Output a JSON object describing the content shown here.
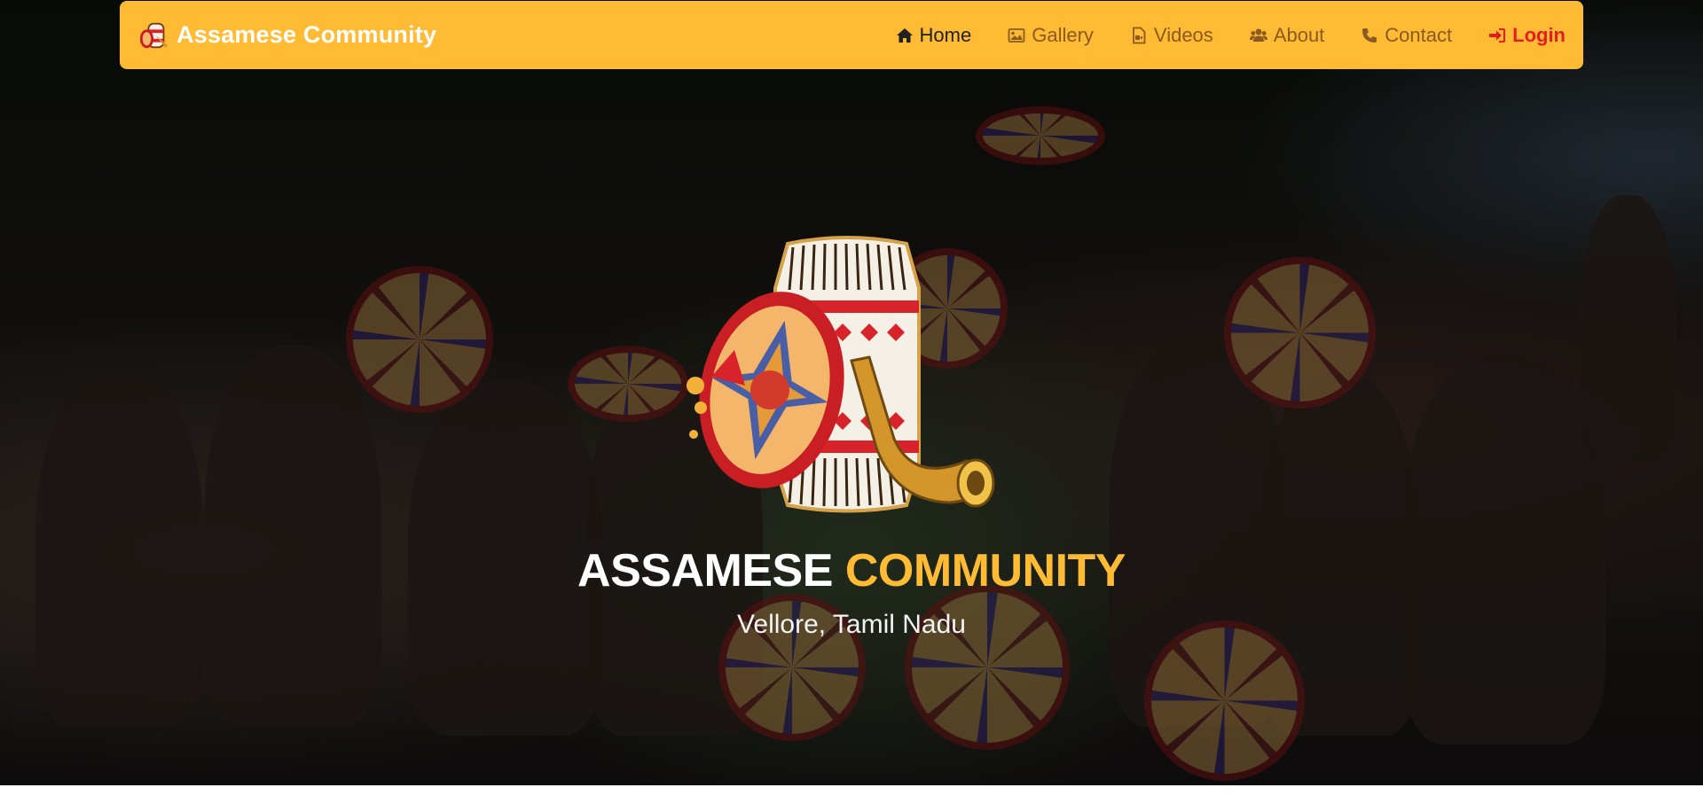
{
  "brand": {
    "name": "Assamese Community"
  },
  "nav": {
    "items": [
      {
        "label": "Home",
        "icon": "home-icon",
        "active": true
      },
      {
        "label": "Gallery",
        "icon": "image-icon"
      },
      {
        "label": "Videos",
        "icon": "file-video-icon"
      },
      {
        "label": "About",
        "icon": "users-icon"
      },
      {
        "label": "Contact",
        "icon": "phone-icon"
      }
    ],
    "login": {
      "label": "Login",
      "icon": "sign-in-icon"
    }
  },
  "hero": {
    "title_part1": "ASSAMESE",
    "title_part2": "COMMUNITY",
    "subtitle": "Vellore, Tamil Nadu"
  },
  "colors": {
    "accent": "#ffbb33",
    "login": "#e41e1e",
    "nav_text": "#8a5a22"
  }
}
